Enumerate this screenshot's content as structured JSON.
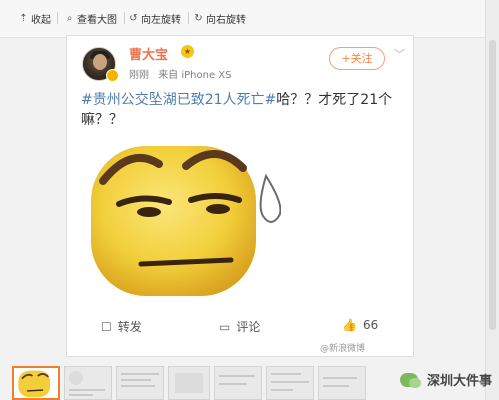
{
  "toolbar": {
    "items": [
      {
        "label": "收起",
        "icon": "collapse-icon"
      },
      {
        "label": "查看大图",
        "icon": "magnifier-icon"
      },
      {
        "label": "向左旋转",
        "icon": "rotate-left-icon"
      },
      {
        "label": "向右旋转",
        "icon": "rotate-right-icon"
      }
    ]
  },
  "post": {
    "username": "曹大宝",
    "time": "刚刚",
    "source": "来自 iPhone XS",
    "follow_label": "+关注",
    "topic": "#贵州公交坠湖已致21人死亡#",
    "text": "哈？？才死了21个嘛？？",
    "actions": {
      "repost": "转发",
      "comment": "评论",
      "likes": "66"
    }
  },
  "watermark": "@新浪微博",
  "footer": {
    "brand": "深圳大件事"
  },
  "colors": {
    "accent": "#ff8140",
    "username": "#eb7350",
    "topic_link": "#507daf",
    "emoji_yellow": "#f2cf3a"
  }
}
